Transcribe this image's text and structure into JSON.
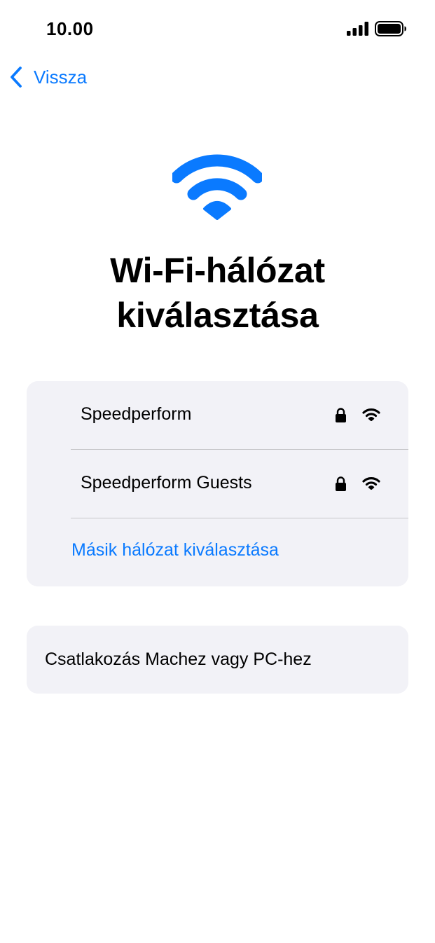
{
  "status_bar": {
    "time": "10.00"
  },
  "navigation": {
    "back_label": "Vissza"
  },
  "title": "Wi-Fi-hálózat kiválasztása",
  "networks": [
    {
      "name": "Speedperform",
      "secured": true,
      "icon": "wifi-icon"
    },
    {
      "name": "Speedperform Guests",
      "secured": true,
      "icon": "wifi-icon"
    }
  ],
  "other_network_label": "Másik hálózat kiválasztása",
  "connect_computer_label": "Csatlakozás Machez vagy PC-hez",
  "colors": {
    "accent": "#0A7AFF",
    "card_background": "#F2F2F7",
    "divider": "#C6C6C8"
  }
}
